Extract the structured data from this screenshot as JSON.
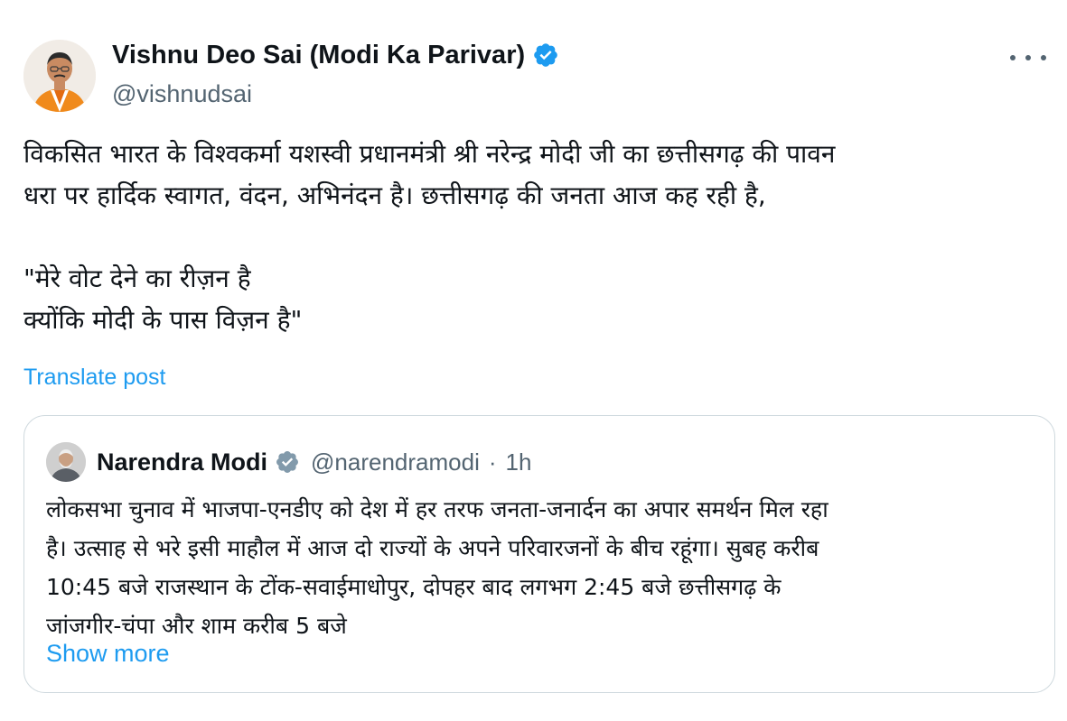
{
  "author": {
    "display_name": "Vishnu Deo Sai (Modi Ka Parivar)",
    "handle": "@vishnudsai",
    "verified_icon": "verified-badge-icon",
    "avatar_icon": "avatar"
  },
  "more_menu": {
    "icon": "more-dots-icon"
  },
  "post": {
    "paragraph1_line1": "विकसित भारत के विश्वकर्मा यशस्वी प्रधानमंत्री श्री नरेन्द्र मोदी जी का छत्तीसगढ़ की पावन",
    "paragraph1_line2": "धरा पर हार्दिक स्वागत, वंदन, अभिनंदन है। छत्तीसगढ़ की जनता आज कह रही है,",
    "paragraph2_line1": "\"मेरे वोट देने का रीज़न है",
    "paragraph2_line2": "क्योंकि मोदी के पास विज़न है\""
  },
  "translate_label": "Translate post",
  "quoted_post": {
    "display_name": "Narendra Modi",
    "handle": "@narendramodi",
    "separator": "·",
    "time": "1h",
    "lines": [
      "लोकसभा चुनाव में भाजपा-एनडीए को देश में हर तरफ जनता-जनार्दन का अपार समर्थन मिल रहा",
      "है। उत्साह से भरे इसी माहौल में आज दो राज्यों के अपने परिवारजनों के बीच रहूंगा। सुबह करीब",
      "10:45 बजे राजस्थान के टोंक-सवाईमाधोपुर, दोपहर बाद लगभग 2:45 बजे छत्तीसगढ़ के",
      "जांजगीर-चंपा और शाम करीब 5 बजे"
    ],
    "show_more_label": "Show more"
  },
  "colors": {
    "accent": "#1d9bf0",
    "text_primary": "#0f1419",
    "text_secondary": "#536471",
    "border": "#cfd9de",
    "verified_badge": "#1d9bf0"
  }
}
